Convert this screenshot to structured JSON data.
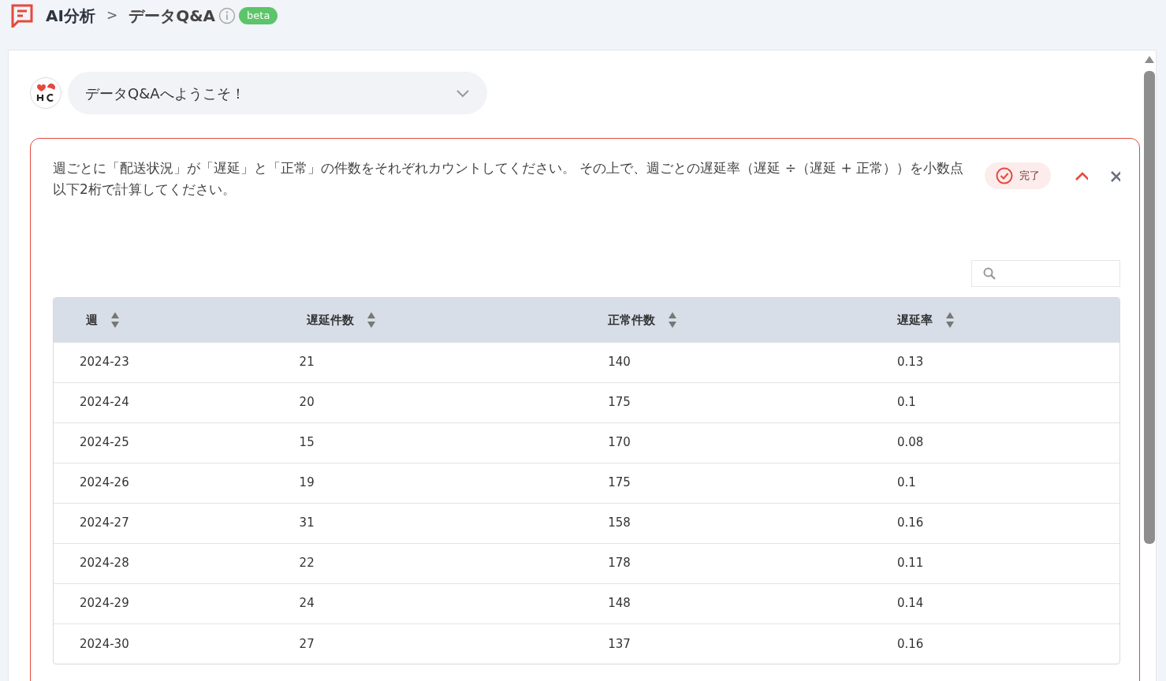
{
  "breadcrumb": {
    "section": "AI分析",
    "separator": ">",
    "page": "データQ&A",
    "badge": "beta"
  },
  "welcome": {
    "title": "データQ&Aへようこそ！",
    "expanded": false
  },
  "query": {
    "text": "週ごとに「配送状況」が「遅延」と「正常」の件数をそれぞれカウントしてください。 その上で、週ごとの遅延率（遅延 ÷（遅延 + 正常））を小数点以下2桁で計算してください。",
    "status": "完了",
    "expanded": true
  },
  "table": {
    "columns": [
      "週",
      "遅延件数",
      "正常件数",
      "遅延率"
    ],
    "rows": [
      [
        "2024-23",
        "21",
        "140",
        "0.13"
      ],
      [
        "2024-24",
        "20",
        "175",
        "0.1"
      ],
      [
        "2024-25",
        "15",
        "170",
        "0.08"
      ],
      [
        "2024-26",
        "19",
        "175",
        "0.1"
      ],
      [
        "2024-27",
        "31",
        "158",
        "0.16"
      ],
      [
        "2024-28",
        "22",
        "178",
        "0.11"
      ],
      [
        "2024-29",
        "24",
        "148",
        "0.14"
      ],
      [
        "2024-30",
        "27",
        "137",
        "0.16"
      ]
    ]
  }
}
